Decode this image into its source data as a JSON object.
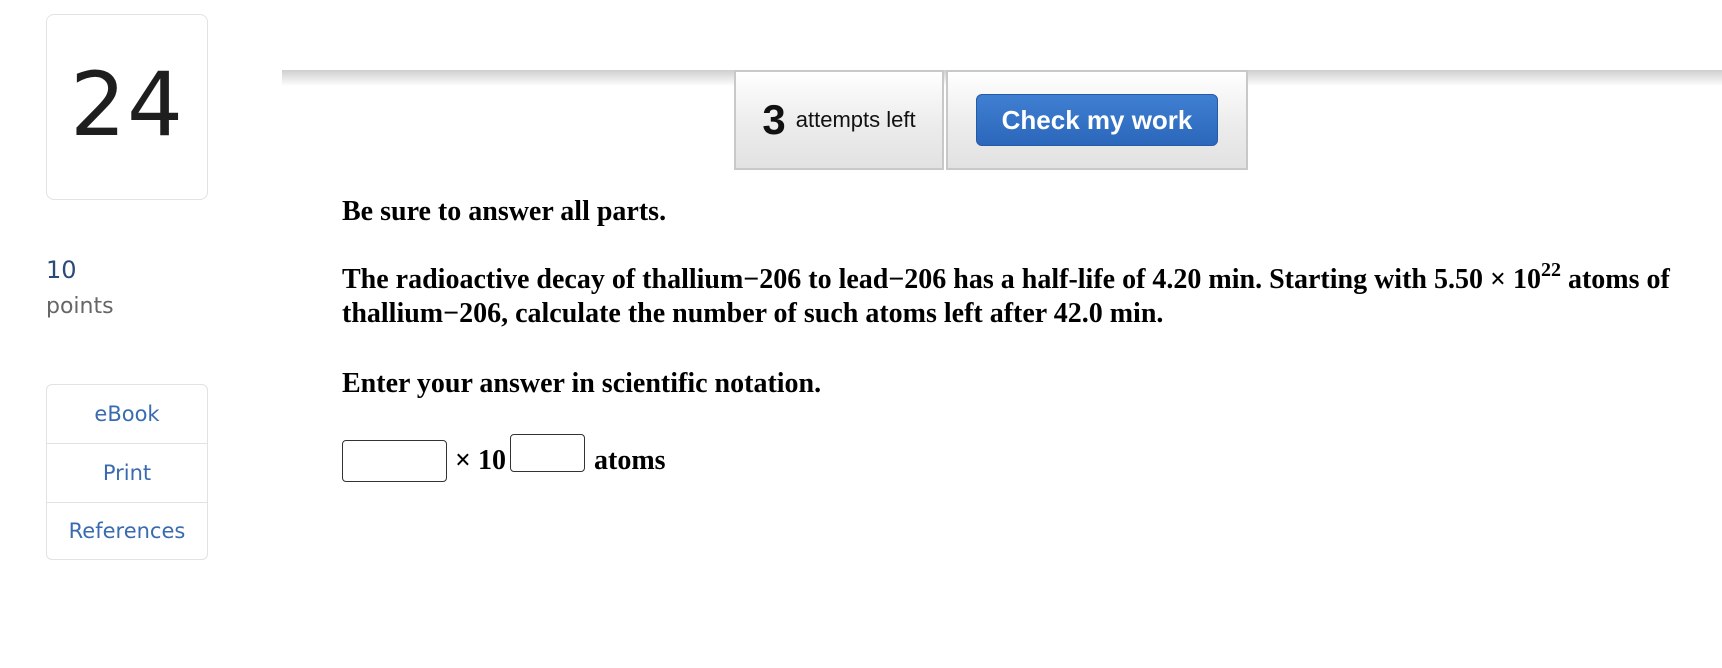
{
  "question": {
    "number": "24",
    "points_value": "10",
    "points_label": "points"
  },
  "tools": [
    {
      "label": "eBook"
    },
    {
      "label": "Print"
    },
    {
      "label": "References"
    }
  ],
  "attempts": {
    "count": "3",
    "label": "attempts left"
  },
  "check_button": {
    "label": "Check my work"
  },
  "content": {
    "instruction": "Be sure to answer all parts.",
    "problem_main": "The radioactive decay of thallium−206 to lead−206 has a half-life of 4.20 min. Starting with 5.50 × 10",
    "problem_exponent": "22",
    "problem_tail": " atoms of thallium−206, calculate the number of such atoms left after 42.0 min.",
    "notation_hint": "Enter your answer in scientific notation."
  },
  "answer": {
    "mantissa_value": "",
    "times_ten": "× 10",
    "exponent_value": "",
    "unit": "atoms"
  }
}
